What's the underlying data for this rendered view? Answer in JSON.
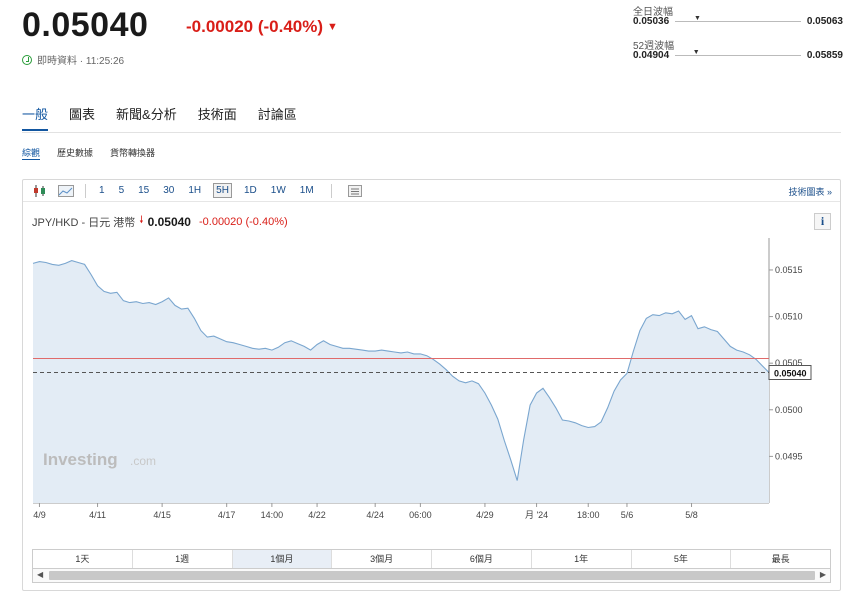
{
  "quote": {
    "price": "0.05040",
    "change": "-0.00020 (-0.40%)",
    "realtime_label": "即時資料 · 11:25:26"
  },
  "ranges": {
    "day": {
      "title": "全日波幅",
      "low": "0.05036",
      "high": "0.05063",
      "marker": 0.15
    },
    "week52": {
      "title": "52週波幅",
      "low": "0.04904",
      "high": "0.05859",
      "marker": 0.14
    }
  },
  "tabs": [
    "一般",
    "圖表",
    "新聞&分析",
    "技術面",
    "討論區"
  ],
  "subtabs": [
    "綜觀",
    "歷史數據",
    "貨幣轉換器"
  ],
  "toolbar": {
    "intervals": [
      "1",
      "5",
      "15",
      "30",
      "1H",
      "5H",
      "1D",
      "1W",
      "1M"
    ],
    "active_interval": "5H",
    "tech_chart_link": "技術圖表 »"
  },
  "chart_header": {
    "pair": "JPY/HKD - 日元 港幣",
    "price": "0.05040",
    "change": "-0.00020 (-0.40%)",
    "info": "i"
  },
  "watermark": {
    "brand": "Investing",
    "suffix": ".com"
  },
  "periods": [
    "1天",
    "1週",
    "1個月",
    "3個月",
    "6個月",
    "1年",
    "5年",
    "最長"
  ],
  "active_period": "1個月",
  "colors": {
    "accent": "#1256a0",
    "down": "#d91e18",
    "line": "#7aa6cf",
    "fill": "#e3ecf5",
    "ref": "#e06a6a"
  },
  "chart_data": {
    "type": "area",
    "title": "",
    "xlabel": "",
    "ylabel": "",
    "ylim": [
      0.049,
      0.0518
    ],
    "yticks": [
      "0.0495",
      "0.0500",
      "0.0505",
      "0.0510",
      "0.0515"
    ],
    "xticks": [
      "4/9",
      "4/11",
      "4/15",
      "4/17",
      "14:00",
      "4/22",
      "4/24",
      "06:00",
      "4/29",
      "月 '24",
      "18:00",
      "5/6",
      "5/8"
    ],
    "xtick_index": [
      1,
      10,
      20,
      30,
      37,
      44,
      53,
      60,
      70,
      78,
      86,
      92,
      102
    ],
    "reference_line": 0.05055,
    "last_price": 0.0504,
    "last_label": "0.05040",
    "series": [
      {
        "values": [
          0.05157,
          0.05159,
          0.05158,
          0.05156,
          0.05155,
          0.05157,
          0.0516,
          0.05158,
          0.05156,
          0.05145,
          0.05133,
          0.05127,
          0.05125,
          0.05126,
          0.05117,
          0.05115,
          0.05116,
          0.05114,
          0.05115,
          0.05113,
          0.05116,
          0.0512,
          0.05112,
          0.05108,
          0.05109,
          0.05098,
          0.05085,
          0.05078,
          0.05079,
          0.05076,
          0.05073,
          0.05072,
          0.0507,
          0.05068,
          0.05066,
          0.05065,
          0.05066,
          0.05064,
          0.05067,
          0.05072,
          0.05074,
          0.05071,
          0.05068,
          0.05064,
          0.0507,
          0.05074,
          0.0507,
          0.05068,
          0.05066,
          0.05066,
          0.05065,
          0.05064,
          0.05063,
          0.05063,
          0.05064,
          0.05063,
          0.05062,
          0.05061,
          0.05062,
          0.0506,
          0.0506,
          0.05058,
          0.05054,
          0.05049,
          0.05043,
          0.05036,
          0.05031,
          0.05029,
          0.05031,
          0.05028,
          0.05018,
          0.05005,
          0.0499,
          0.04967,
          0.04946,
          0.04924,
          0.04968,
          0.05005,
          0.05018,
          0.05023,
          0.05013,
          0.05002,
          0.04989,
          0.04988,
          0.04986,
          0.04983,
          0.04981,
          0.04982,
          0.04987,
          0.05002,
          0.0502,
          0.05032,
          0.05039,
          0.05063,
          0.05085,
          0.05098,
          0.05102,
          0.05101,
          0.05104,
          0.05103,
          0.05106,
          0.05097,
          0.05101,
          0.05087,
          0.05089,
          0.05086,
          0.05084,
          0.05076,
          0.05068,
          0.05064,
          0.05062,
          0.05059,
          0.05054,
          0.05047,
          0.0504
        ]
      }
    ]
  }
}
